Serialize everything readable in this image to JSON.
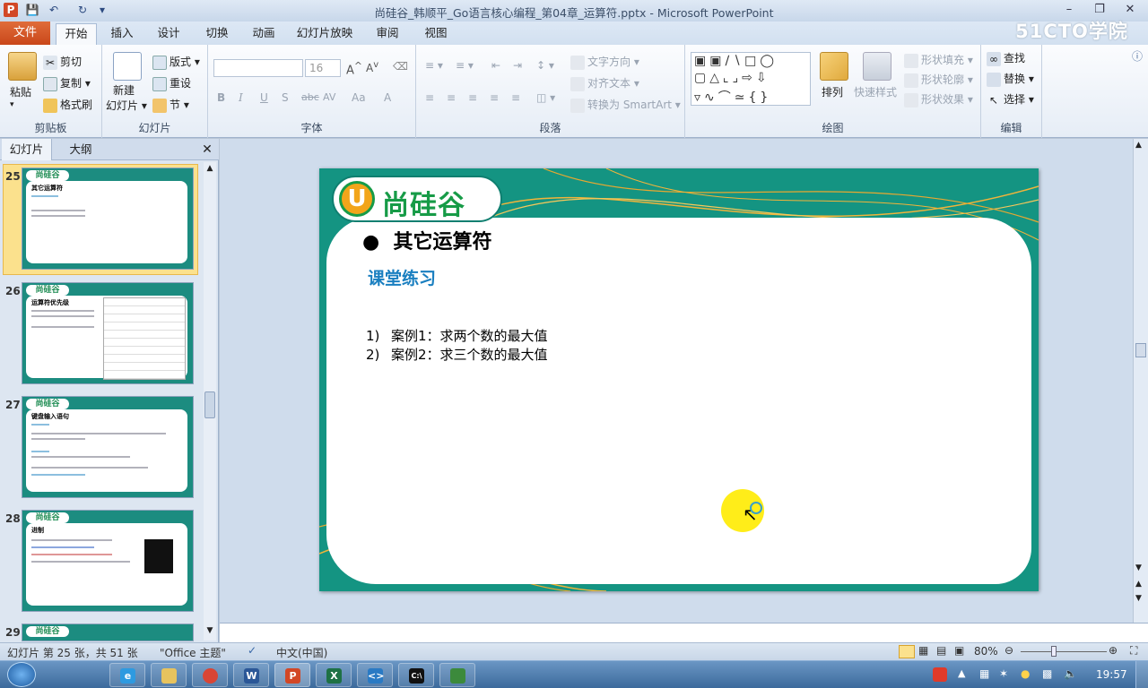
{
  "window": {
    "title": "尚硅谷_韩顺平_Go语言核心编程_第04章_运算符.pptx - Microsoft PowerPoint",
    "watermark": "51CTO学院"
  },
  "tabs": {
    "file": "文件",
    "items": [
      "开始",
      "插入",
      "设计",
      "切换",
      "动画",
      "幻灯片放映",
      "审阅",
      "视图"
    ]
  },
  "ribbon": {
    "clipboard": {
      "label": "剪贴板",
      "paste": "粘贴",
      "cut": "剪切",
      "copy": "复制",
      "format_painter": "格式刷"
    },
    "slides": {
      "label": "幻灯片",
      "new_slide_1": "新建",
      "new_slide_2": "幻灯片",
      "layout": "版式",
      "reset": "重设",
      "section": "节"
    },
    "font": {
      "label": "字体",
      "size": "16",
      "bold": "B",
      "italic": "I",
      "underline": "U",
      "shadow": "S",
      "strike": "abc",
      "spacing": "AV",
      "case": "Aa"
    },
    "paragraph": {
      "label": "段落",
      "text_direction": "文字方向",
      "align_text": "对齐文本",
      "smartart": "转换为 SmartArt"
    },
    "drawing": {
      "label": "绘图",
      "arrange": "排列",
      "quick_styles": "快速样式",
      "shape_fill": "形状填充",
      "shape_outline": "形状轮廓",
      "shape_effects": "形状效果"
    },
    "editing": {
      "label": "编辑",
      "find": "查找",
      "replace": "替换",
      "select": "选择"
    }
  },
  "panel": {
    "tab_slides": "幻灯片",
    "tab_outline": "大纲",
    "thumbnails": [
      {
        "num": "25",
        "title": "其它运算符"
      },
      {
        "num": "26",
        "title": "运算符优先级"
      },
      {
        "num": "27",
        "title": "键盘输入语句"
      },
      {
        "num": "28",
        "title": "进制"
      },
      {
        "num": "29",
        "title": ""
      }
    ]
  },
  "slide": {
    "logo": "尚硅谷",
    "bullet_title": "其它运算符",
    "subtitle": "课堂练习",
    "items": [
      {
        "n": "1)",
        "text": "案例1：求两个数的最大值"
      },
      {
        "n": "2)",
        "text": "案例2：求三个数的最大值"
      }
    ]
  },
  "status": {
    "slide_info": "幻灯片 第 25 张，共 51 张",
    "theme": "\"Office 主题\"",
    "language": "中文(中国)",
    "zoom": "80%"
  },
  "taskbar": {
    "clock": "19:57"
  }
}
